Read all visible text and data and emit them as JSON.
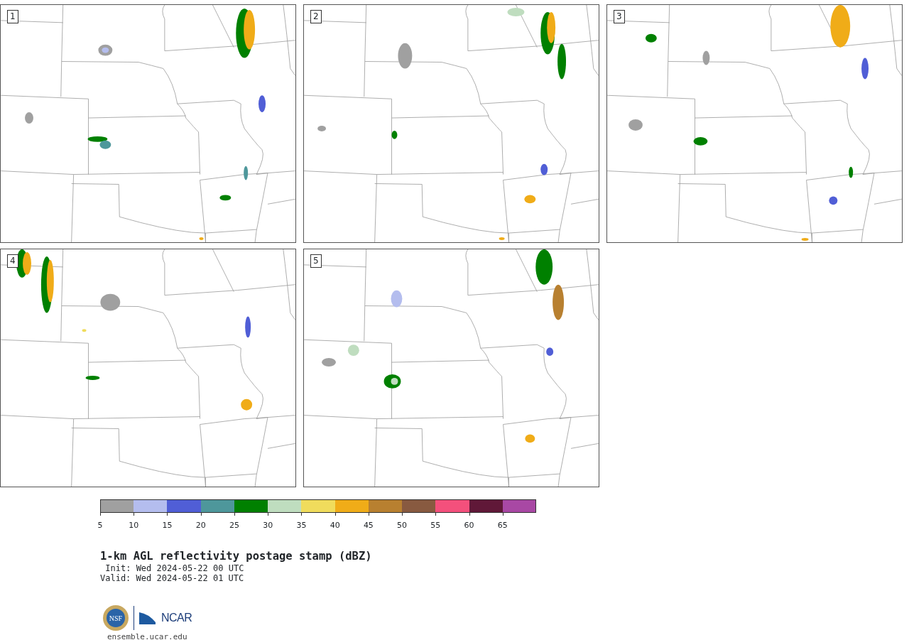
{
  "panels": [
    {
      "label": "1"
    },
    {
      "label": "2"
    },
    {
      "label": "3"
    },
    {
      "label": "4"
    },
    {
      "label": "5"
    }
  ],
  "colorbar": {
    "bins": [
      {
        "color": "#a0a0a0"
      },
      {
        "color": "#b4bdee"
      },
      {
        "color": "#505ed6"
      },
      {
        "color": "#4e979b"
      },
      {
        "color": "#008000"
      },
      {
        "color": "#bfddbf"
      },
      {
        "color": "#f0dc5c"
      },
      {
        "color": "#f0ac18"
      },
      {
        "color": "#b88030"
      },
      {
        "color": "#885a40"
      },
      {
        "color": "#f4507c"
      },
      {
        "color": "#601838"
      },
      {
        "color": "#a848a4"
      }
    ],
    "tick_labels": [
      "5",
      "10",
      "15",
      "20",
      "25",
      "30",
      "35",
      "40",
      "45",
      "50",
      "55",
      "60",
      "65"
    ]
  },
  "title": "1-km AGL reflectivity postage stamp (dBZ)",
  "init": "Init: Wed 2024-05-22 00 UTC",
  "valid": "Valid: Wed 2024-05-22 01 UTC",
  "logos": {
    "nsf": "NSF",
    "ncar": "NCAR"
  },
  "url": "ensemble.ucar.edu"
}
